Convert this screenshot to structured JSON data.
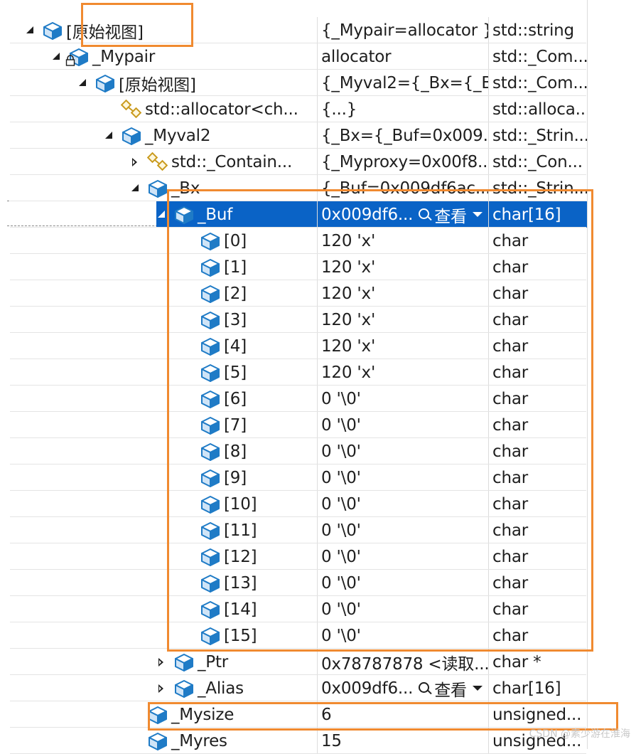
{
  "rows": [
    {
      "indent": 1,
      "expander": "expanded",
      "icon": "field",
      "name": "[原始视图]",
      "value": "{_Mypair=allocator }",
      "type": "std::string",
      "locked": false
    },
    {
      "indent": 2,
      "expander": "expanded",
      "icon": "field",
      "name": "_Mypair",
      "value": "allocator",
      "type": "std::_Com...",
      "locked": true
    },
    {
      "indent": 3,
      "expander": "expanded",
      "icon": "field",
      "name": "[原始视图]",
      "value": "{_Myval2={_Bx={_B...",
      "type": "std::_Com...",
      "locked": false
    },
    {
      "indent": 4,
      "expander": "none",
      "icon": "base-class",
      "name": "std::allocator<ch...",
      "value": "{...}",
      "type": "std::alloca...",
      "locked": false
    },
    {
      "indent": 4,
      "expander": "expanded",
      "icon": "field",
      "name": "_Myval2",
      "value": "{_Bx={_Buf=0x009...",
      "type": "std::_Strin...",
      "locked": false
    },
    {
      "indent": 5,
      "expander": "collapsed",
      "icon": "base-class",
      "name": "std::_Contain...",
      "value": "{_Myproxy=0x00f8...",
      "type": "std::_Con...",
      "locked": false
    },
    {
      "indent": 5,
      "expander": "expanded",
      "icon": "field",
      "name": "_Bx",
      "value": "{_Buf=0x009df6ac...",
      "type": "std::_Strin...",
      "locked": false
    },
    {
      "indent": 6,
      "expander": "expanded",
      "icon": "field",
      "name": "_Buf",
      "value": "0x009df6...",
      "type": "char[16]",
      "locked": false,
      "selected": true,
      "viewer": true
    },
    {
      "indent": 7,
      "expander": "none",
      "icon": "field",
      "name": "[0]",
      "value": "120 'x'",
      "type": "char",
      "locked": false
    },
    {
      "indent": 7,
      "expander": "none",
      "icon": "field",
      "name": "[1]",
      "value": "120 'x'",
      "type": "char",
      "locked": false
    },
    {
      "indent": 7,
      "expander": "none",
      "icon": "field",
      "name": "[2]",
      "value": "120 'x'",
      "type": "char",
      "locked": false
    },
    {
      "indent": 7,
      "expander": "none",
      "icon": "field",
      "name": "[3]",
      "value": "120 'x'",
      "type": "char",
      "locked": false
    },
    {
      "indent": 7,
      "expander": "none",
      "icon": "field",
      "name": "[4]",
      "value": "120 'x'",
      "type": "char",
      "locked": false
    },
    {
      "indent": 7,
      "expander": "none",
      "icon": "field",
      "name": "[5]",
      "value": "120 'x'",
      "type": "char",
      "locked": false
    },
    {
      "indent": 7,
      "expander": "none",
      "icon": "field",
      "name": "[6]",
      "value": "0 '\\0'",
      "type": "char",
      "locked": false
    },
    {
      "indent": 7,
      "expander": "none",
      "icon": "field",
      "name": "[7]",
      "value": "0 '\\0'",
      "type": "char",
      "locked": false
    },
    {
      "indent": 7,
      "expander": "none",
      "icon": "field",
      "name": "[8]",
      "value": "0 '\\0'",
      "type": "char",
      "locked": false
    },
    {
      "indent": 7,
      "expander": "none",
      "icon": "field",
      "name": "[9]",
      "value": "0 '\\0'",
      "type": "char",
      "locked": false
    },
    {
      "indent": 7,
      "expander": "none",
      "icon": "field",
      "name": "[10]",
      "value": "0 '\\0'",
      "type": "char",
      "locked": false
    },
    {
      "indent": 7,
      "expander": "none",
      "icon": "field",
      "name": "[11]",
      "value": "0 '\\0'",
      "type": "char",
      "locked": false
    },
    {
      "indent": 7,
      "expander": "none",
      "icon": "field",
      "name": "[12]",
      "value": "0 '\\0'",
      "type": "char",
      "locked": false
    },
    {
      "indent": 7,
      "expander": "none",
      "icon": "field",
      "name": "[13]",
      "value": "0 '\\0'",
      "type": "char",
      "locked": false
    },
    {
      "indent": 7,
      "expander": "none",
      "icon": "field",
      "name": "[14]",
      "value": "0 '\\0'",
      "type": "char",
      "locked": false
    },
    {
      "indent": 7,
      "expander": "none",
      "icon": "field",
      "name": "[15]",
      "value": "0 '\\0'",
      "type": "char",
      "locked": false
    },
    {
      "indent": 6,
      "expander": "collapsed",
      "icon": "field",
      "name": "_Ptr",
      "value": "0x78787878 <读取...",
      "type": "char *",
      "locked": false
    },
    {
      "indent": 6,
      "expander": "collapsed",
      "icon": "field",
      "name": "_Alias",
      "value": "0x009df6...",
      "type": "char[16]",
      "locked": false,
      "viewer": true
    },
    {
      "indent": 5,
      "expander": "none",
      "icon": "field",
      "name": "_Mysize",
      "value": "6",
      "type": "unsigned...",
      "locked": false
    },
    {
      "indent": 5,
      "expander": "none",
      "icon": "field",
      "name": "_Myres",
      "value": "15",
      "type": "unsigned...",
      "locked": false
    }
  ],
  "viewer_label": "查看",
  "colors": {
    "selection": "#0a63c6",
    "highlight_box": "#f08a30",
    "icon_field": "#1f7bc6",
    "icon_base": "#c99a1c"
  },
  "watermark": "CSDN @素少游在淮海"
}
